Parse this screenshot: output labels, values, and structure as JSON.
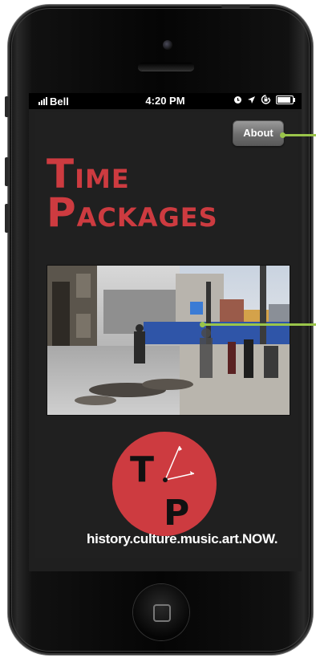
{
  "status_bar": {
    "carrier": "Bell",
    "time": "4:20 PM",
    "battery_level": 0.9
  },
  "app": {
    "about_label": "About",
    "title": {
      "line1_initial": "T",
      "line1_rest": "IME",
      "line2_initial": "P",
      "line2_rest": "ACKAGES"
    },
    "logo": {
      "letter_top": "T",
      "letter_bottom": "P"
    },
    "tagline": "history.culture.music.art.NOW."
  },
  "colors": {
    "brand_red": "#cd3b40",
    "app_background": "#202020",
    "callout_green": "#9ac54a"
  },
  "icons": [
    "signal-bars-icon",
    "alarm-icon",
    "location-arrow-icon",
    "rotation-lock-icon",
    "battery-icon",
    "home-button-icon",
    "clock-hands-icon"
  ]
}
